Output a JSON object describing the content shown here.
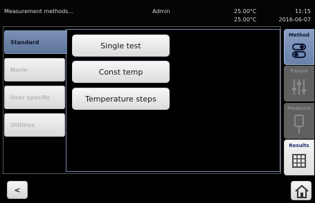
{
  "status": {
    "title": "Measurement methods...",
    "user": "Admin",
    "temp1": "25.00°C",
    "temp2": "25.00°C",
    "time": "11:15",
    "date": "2016-06-07"
  },
  "categories": [
    {
      "label": "Standard",
      "active": true
    },
    {
      "label": "Norm",
      "active": false
    },
    {
      "label": "User specific",
      "active": false
    },
    {
      "label": "Utilities",
      "active": false
    }
  ],
  "methods": [
    {
      "label": "Single test"
    },
    {
      "label": "Const temp"
    },
    {
      "label": "Temperature steps"
    }
  ],
  "tabs": [
    {
      "label": "Method",
      "icon": "toggle-icon",
      "state": "active"
    },
    {
      "label": "Param",
      "icon": "sliders-icon",
      "state": "disabled"
    },
    {
      "label": "Measure",
      "icon": "probe-icon",
      "state": "disabled"
    },
    {
      "label": "Results",
      "icon": "table-icon",
      "state": "enabled"
    }
  ],
  "footer": {
    "back_label": "<",
    "home_icon": "home-icon"
  },
  "colors": {
    "accent": "#6a82aa",
    "button_bg": "#e9e9e9",
    "background": "#000000"
  }
}
